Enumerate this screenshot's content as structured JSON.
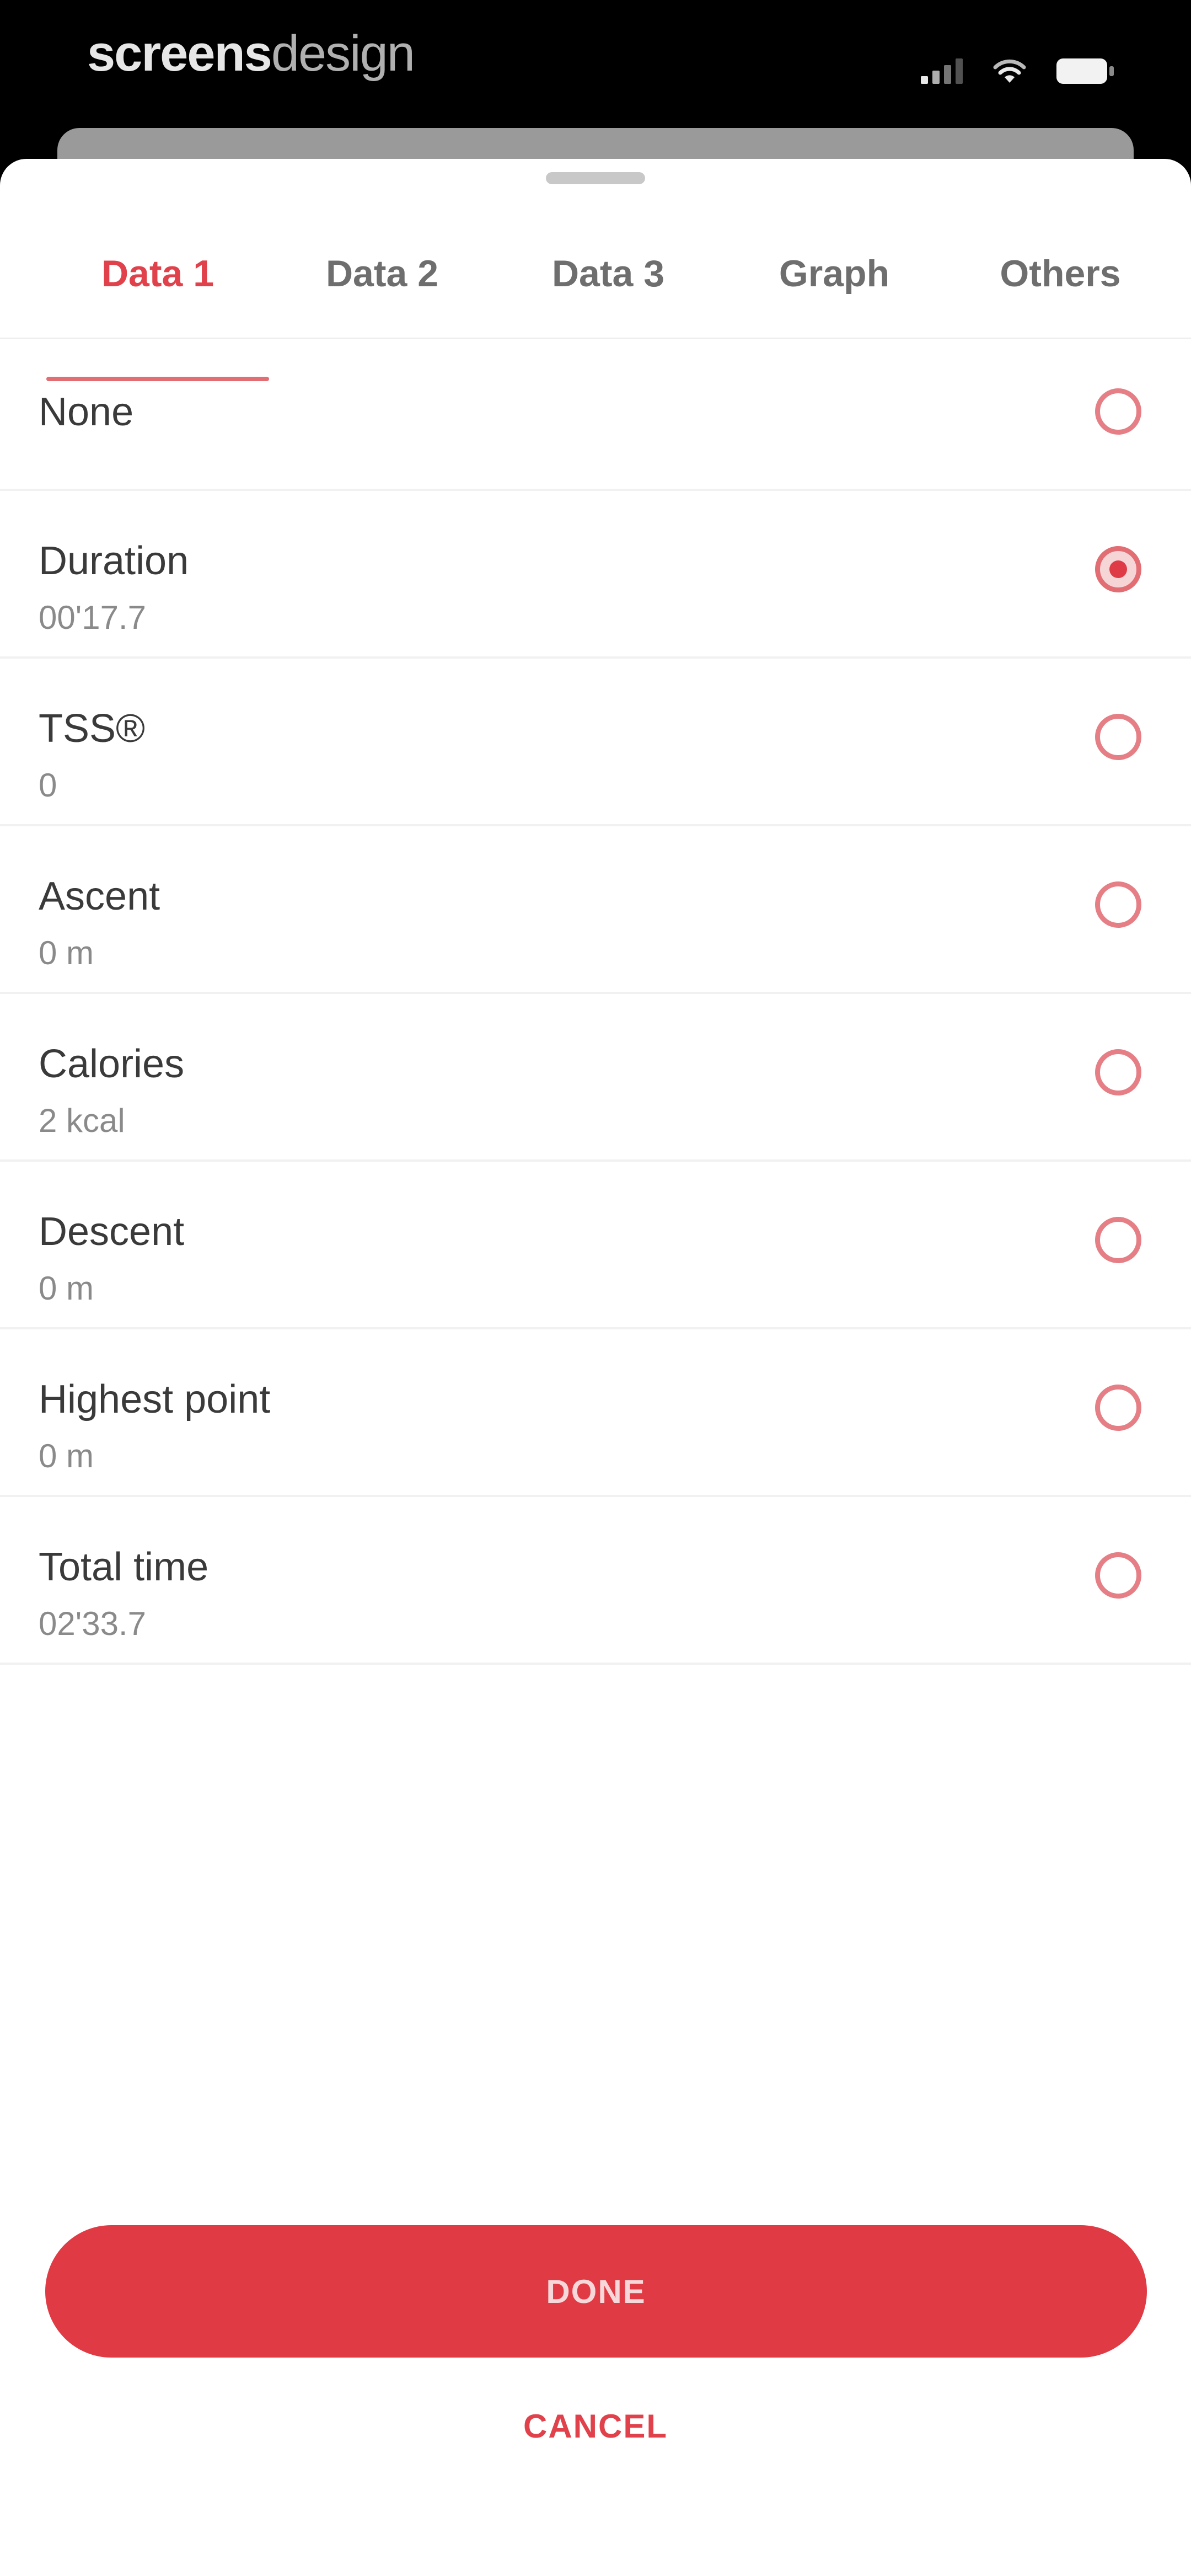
{
  "status_bar": {
    "brand_bold": "screens",
    "brand_light": "design"
  },
  "tabs": [
    {
      "label": "Data 1",
      "active": true
    },
    {
      "label": "Data 2",
      "active": false
    },
    {
      "label": "Data 3",
      "active": false
    },
    {
      "label": "Graph",
      "active": false
    },
    {
      "label": "Others",
      "active": false
    }
  ],
  "options": [
    {
      "title": "None",
      "value": "",
      "selected": false
    },
    {
      "title": "Duration",
      "value": "00'17.7",
      "selected": true
    },
    {
      "title": "TSS®",
      "value": "0",
      "selected": false
    },
    {
      "title": "Ascent",
      "value": "0 m",
      "selected": false
    },
    {
      "title": "Calories",
      "value": "2 kcal",
      "selected": false
    },
    {
      "title": "Descent",
      "value": "0 m",
      "selected": false
    },
    {
      "title": "Highest point",
      "value": "0 m",
      "selected": false
    },
    {
      "title": "Total time",
      "value": "02'33.7",
      "selected": false
    }
  ],
  "buttons": {
    "done": "DONE",
    "cancel": "CANCEL"
  },
  "colors": {
    "accent": "#e03a44",
    "background": "#ffffff",
    "status_bar": "#000000"
  }
}
